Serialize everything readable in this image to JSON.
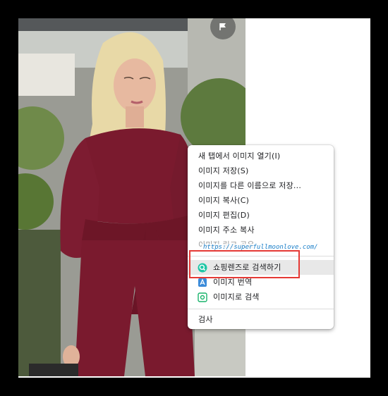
{
  "context_menu": {
    "items": [
      {
        "label": "새 탭에서 이미지 열기(I)"
      },
      {
        "label": "이미지 저장(S)"
      },
      {
        "label": "이미지를 다른 이름으로 저장..."
      },
      {
        "label": "이미지 복사(C)"
      },
      {
        "label": "이미지 편집(D)"
      },
      {
        "label": "이미지 주소 복사"
      }
    ],
    "partial_item": "이미지 링크 공유",
    "lens_items": [
      {
        "label": "쇼핑렌즈로 검색하기",
        "icon": "shopping-lens-icon"
      },
      {
        "label": "이미지 번역",
        "icon": "image-translate-icon"
      },
      {
        "label": "이미지로 검색",
        "icon": "image-search-icon"
      }
    ],
    "inspect_label": "검사"
  },
  "watermark": "https://superfullmoonlove.com/",
  "colors": {
    "highlight": "#e8e8e8",
    "annotation_red": "#e53935",
    "watermark_blue": "#1a7fc9",
    "dress": "#7a1a2e"
  }
}
